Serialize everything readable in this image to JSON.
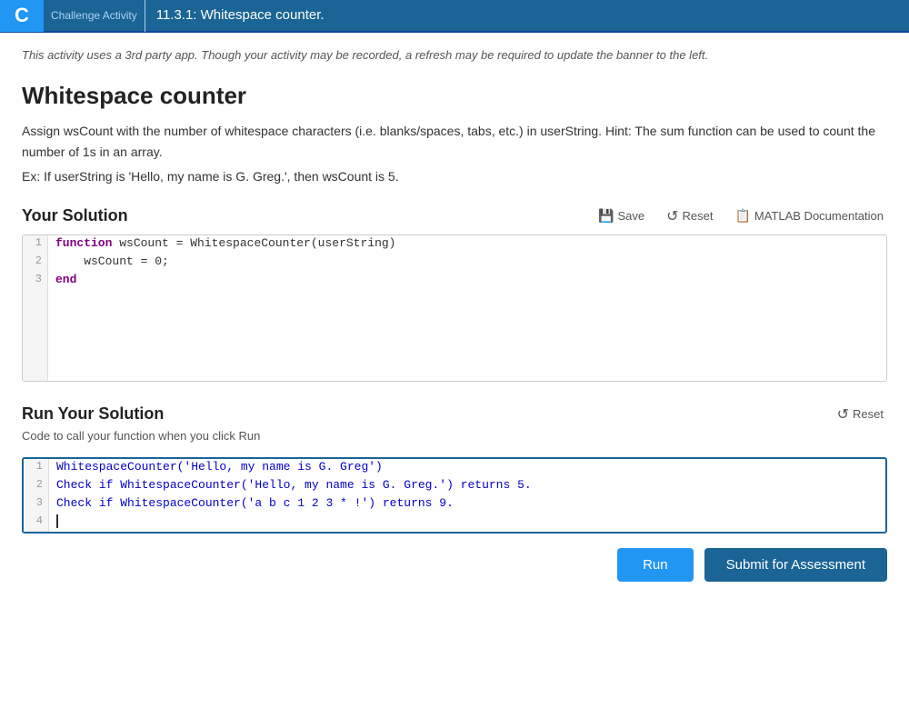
{
  "header": {
    "logo_letter": "C",
    "nav_label": "Challenge Activity",
    "title": "11.3.1: Whitespace counter."
  },
  "notice": "This activity uses a 3rd party app. Though your activity may be recorded, a refresh may be required to update the banner to the left.",
  "page_title": "Whitespace counter",
  "description": "Assign wsCount with the number of whitespace characters (i.e. blanks/spaces, tabs, etc.) in userString. Hint: The sum function can be used to count the number of 1s in an array.",
  "example": "Ex: If userString is 'Hello, my name is G. Greg.', then wsCount is 5.",
  "your_solution": {
    "title": "Your Solution",
    "save_label": "Save",
    "reset_label": "Reset",
    "matlab_label": "MATLAB Documentation",
    "code_lines": [
      {
        "num": "1",
        "text": "function wsCount = WhitespaceCounter(userString)"
      },
      {
        "num": "2",
        "text": "    wsCount = 0;"
      },
      {
        "num": "3",
        "text": "end"
      }
    ]
  },
  "run_solution": {
    "title": "Run Your Solution",
    "subtitle": "Code to call your function when you click Run",
    "reset_label": "Reset",
    "run_lines": [
      {
        "num": "1",
        "text": "WhitespaceCounter('Hello, my name is G. Greg')"
      },
      {
        "num": "2",
        "text": "Check if WhitespaceCounter('Hello, my name is G. Greg.') returns 5."
      },
      {
        "num": "3",
        "text": "Check if WhitespaceCounter('a b c 1 2 3 * !') returns 9."
      },
      {
        "num": "4",
        "text": ""
      }
    ]
  },
  "buttons": {
    "run_label": "Run",
    "submit_label": "Submit for Assessment"
  }
}
